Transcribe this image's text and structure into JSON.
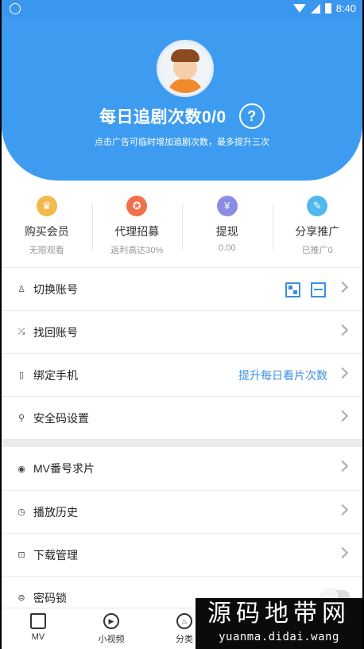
{
  "status_bar": {
    "time": "8:40"
  },
  "header": {
    "title": "每日追剧次数0/0",
    "help_icon": "?",
    "subtitle": "点击广告可临时增加追剧次数，最多提升三次"
  },
  "quick_actions": [
    {
      "label": "购买会员",
      "sub": "无限观看",
      "icon": "crown-icon",
      "color": "#f2b94c"
    },
    {
      "label": "代理招募",
      "sub": "返利高达30%",
      "icon": "medal-icon",
      "color": "#f16f4c"
    },
    {
      "label": "提现",
      "sub": "0.00",
      "icon": "yen-icon",
      "color": "#8b8ce6"
    },
    {
      "label": "分享推广",
      "sub": "已推广0",
      "icon": "share-icon",
      "color": "#4fb8ec"
    }
  ],
  "menu": {
    "switch_account": "切换账号",
    "recover_account": "找回账号",
    "bind_phone": "绑定手机",
    "bind_phone_extra": "提升每日看片次数",
    "security_code": "安全码设置",
    "mv_request": "MV番号求片",
    "history": "播放历史",
    "downloads": "下载管理",
    "pin_lock": "密码锁"
  },
  "bottom_nav": [
    {
      "label": "MV",
      "icon": "home-icon"
    },
    {
      "label": "小视频",
      "icon": "play-icon"
    },
    {
      "label": "分类",
      "icon": "flame-icon"
    }
  ],
  "watermark": {
    "big": "源码地带网",
    "small": "yuanma.didai.wang"
  }
}
